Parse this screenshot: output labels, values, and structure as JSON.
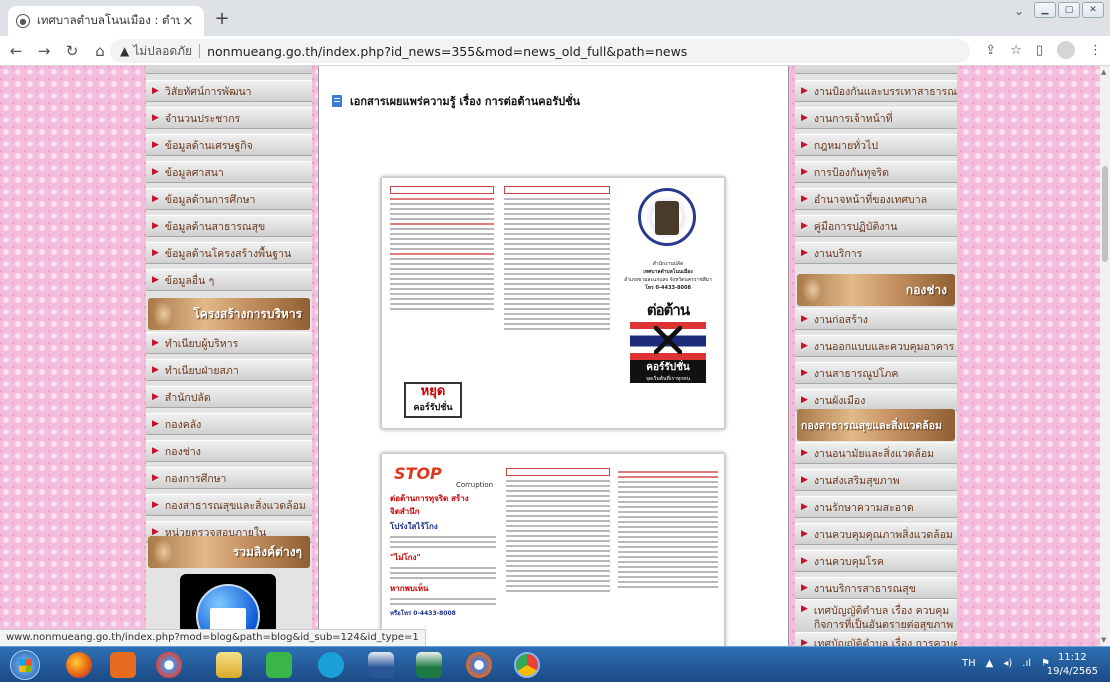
{
  "browser": {
    "tab_title": "เทศบาลตำบลโนนเมือง : ตำบลโนน",
    "tab_close": "×",
    "new_tab": "+",
    "security_label": "ไม่ปลอดภัย",
    "url": "nonmueang.go.th/index.php?id_news=355&mod=news_old_full&path=news",
    "status_url": "www.nonmueang.go.th/index.php?mod=blog&path=blog&id_sub=124&id_type=1"
  },
  "left_menu": {
    "items_top": [
      "วิสัยทัศน์การพัฒนา",
      "จำนวนประชากร",
      "ข้อมูลด้านเศรษฐกิจ",
      "ข้อมูลศาสนา",
      "ข้อมูลด้านการศึกษา",
      "ข้อมูลด้านสาธารณสุข",
      "ข้อมูลด้านโครงสร้างพื้นฐาน",
      "ข้อมูลอื่น ๆ"
    ],
    "section_structure": "โครงสร้างการบริหาร",
    "items_structure": [
      "ทำเนียบผู้บริหาร",
      "ทำเนียบฝ่ายสภา",
      "สำนักปลัด",
      "กองคลัง",
      "กองช่าง",
      "กองการศึกษา",
      "กองสาธารณสุขและสิ่งแวดล้อม",
      "หน่วยตรวจสอบภายใน"
    ],
    "section_links": "รวมลิงค์ต่างๆ"
  },
  "main": {
    "news_title": "เอกสารเผยแพร่ความรู้ เรื่อง การต่อต้านคอรัปชั่น",
    "brochure1": {
      "stop_big": "หยุด",
      "stop_small": "คอร์รัปชั่น",
      "office": "สำนักงานปลัด",
      "municipality": "เทศบาลตำบลโนนเมือง",
      "district": "อำเภอขามสะแกแสง จังหวัดนครราชสีมา",
      "phone": "โทร 0-4433-8008",
      "anti_title": "ต่อต้าน",
      "anti_sub": "คอร์รัปชั่น",
      "anti_note": "จุดเริ่มต้นที่เราทุกคน"
    },
    "brochure2": {
      "stop_word": "STOP",
      "corruption": "Corruption",
      "red_line": "ต่อต้านการทุจริต สร้างจิตสำนึก",
      "blue_line": "โปร่งใสไร้โกง",
      "quote": "\"ไม่โกง\"",
      "red_heading": "หากพบเห็น",
      "phone": "หรือโทร 0-4433-8008"
    }
  },
  "right_menu": {
    "items_top": [
      "งานป้องกันและบรรเทาสาธารณภัย",
      "งานการเจ้าหน้าที่",
      "กฎหมายทั่วไป",
      "การป้องกันทุจริต",
      "อำนาจหน้าที่ของเทศบาล",
      "คู่มือการปฏิบัติงาน",
      "งานบริการ"
    ],
    "section_engineering": "กองช่าง",
    "items_engineering": [
      "งานก่อสร้าง",
      "งานออกแบบและควบคุมอาคาร",
      "งานสาธารณูปโภค",
      "งานผังเมือง"
    ],
    "section_health": "กองสาธารณสุขและสิ่งแวดล้อม",
    "items_health": [
      "งานอนามัยและสิ่งแวดล้อม",
      "งานส่งเสริมสุขภาพ",
      "งานรักษาความสะอาด",
      "งานควบคุมคุณภาพสิ่งแวดล้อม",
      "งานควบคุมโรค",
      "งานบริการสาธารณสุข"
    ],
    "items_laws": [
      "เทศบัญญัติตำบล เรื่อง ควบคุมกิจการที่เป็นอันตรายต่อสุขภาพ",
      "เทศบัญญัติตำบล เรื่อง การควบคุม"
    ]
  },
  "taskbar": {
    "lang": "TH",
    "time": "11:12",
    "date": "19/4/2565"
  },
  "colors": {
    "menu_text": "#6b3a1f",
    "arrow": "#c8102e",
    "page_bg": "#f4bcdc"
  }
}
